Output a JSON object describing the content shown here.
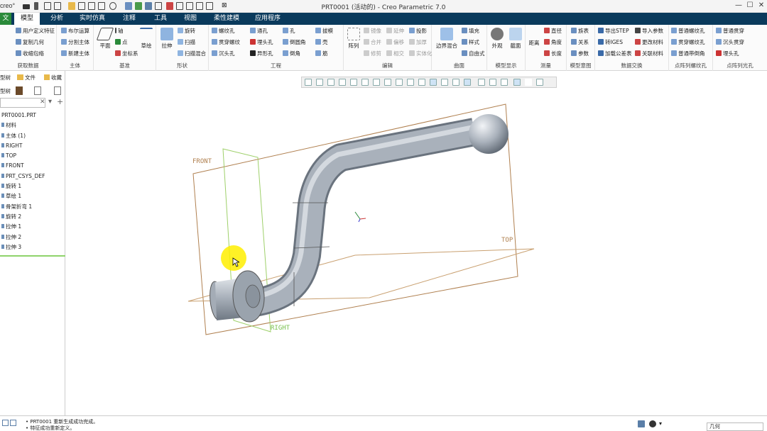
{
  "app": {
    "logo": "creo°",
    "title": "PRT0001 (活动的) - Creo Parametric 7.0"
  },
  "tabs": {
    "file": "文件",
    "model": "模型",
    "analysis": "分析",
    "sim": "实时仿真",
    "annot": "注释",
    "tools": "工具",
    "view": "视图",
    "flex": "柔性建模",
    "apps": "应用程序"
  },
  "ribbon": {
    "get_data": {
      "label": "获取数据",
      "items": [
        "用户定义特征",
        "复制几何",
        "收缩包络"
      ]
    },
    "body": {
      "label": "主体",
      "items": [
        "布尔运算",
        "分割主体",
        "新建主体"
      ]
    },
    "datum": {
      "label": "基准",
      "plane": "平面",
      "axis": "轴",
      "point": "点",
      "csys": "坐标系",
      "sketch": "草绘"
    },
    "shapes": {
      "label": "形状",
      "extrude": "拉伸",
      "revolve": "旋转",
      "sweep": "扫描",
      "swept_blend": "扫描混合"
    },
    "engineering": {
      "label": "工程",
      "items": [
        "螺纹孔",
        "贯穿螺纹",
        "沉头孔",
        "通孔",
        "埋头孔",
        "异形孔",
        "孔",
        "倒圆角",
        "倒角",
        "拔模",
        "壳",
        "筋"
      ]
    },
    "editing": {
      "label": "编辑",
      "pattern": "阵列",
      "items": [
        "镜像",
        "合并",
        "修剪",
        "延伸",
        "偏移",
        "相交",
        "投影",
        "加厚",
        "实体化"
      ]
    },
    "surfaces": {
      "label": "曲面",
      "boundary": "边界混合",
      "fill": "填充",
      "style": "样式",
      "freestyle": "自由式"
    },
    "display": {
      "label": "模型显示",
      "appearance": "外观",
      "section": "截面"
    },
    "measure": {
      "label": "测量",
      "distance": "距离",
      "items": [
        "直径",
        "角度",
        "长度"
      ]
    },
    "intent": {
      "label": "模型意图",
      "items": [
        "族表",
        "关系",
        "参数"
      ]
    },
    "exchange": {
      "label": "数据交换",
      "items": [
        "导出STEP",
        "转IGES",
        "加载公差表",
        "导入参数",
        "更改材料",
        "关联材料"
      ]
    },
    "thread_pattern": {
      "label": "点阵列螺纹孔",
      "items": [
        "普通螺纹孔",
        "贯穿螺纹孔",
        "普通带倒角"
      ]
    },
    "hole_pattern": {
      "label": "点阵列光孔",
      "items": [
        "普通贯穿",
        "沉头贯穿",
        "埋头孔"
      ]
    }
  },
  "panel": {
    "tab_tree": "型树",
    "tab_files": "文件",
    "tab_fav": "收藏",
    "tree_label": "型树"
  },
  "tree": [
    "PRT0001.PRT",
    "材料",
    "主体 (1)",
    "RIGHT",
    "TOP",
    "FRONT",
    "PRT_CSYS_DEF",
    "旋转 1",
    "草绘 1",
    "骨架折弯 1",
    "旋转 2",
    "拉伸 1",
    "拉伸 2",
    "拉伸 3"
  ],
  "planes": {
    "front": "FRONT",
    "top": "TOP",
    "right": "RIGHT"
  },
  "status": {
    "line1": "PRT0001 重新生成成功完成。",
    "line2": "特征成功重新定义。",
    "filter": "几何"
  }
}
